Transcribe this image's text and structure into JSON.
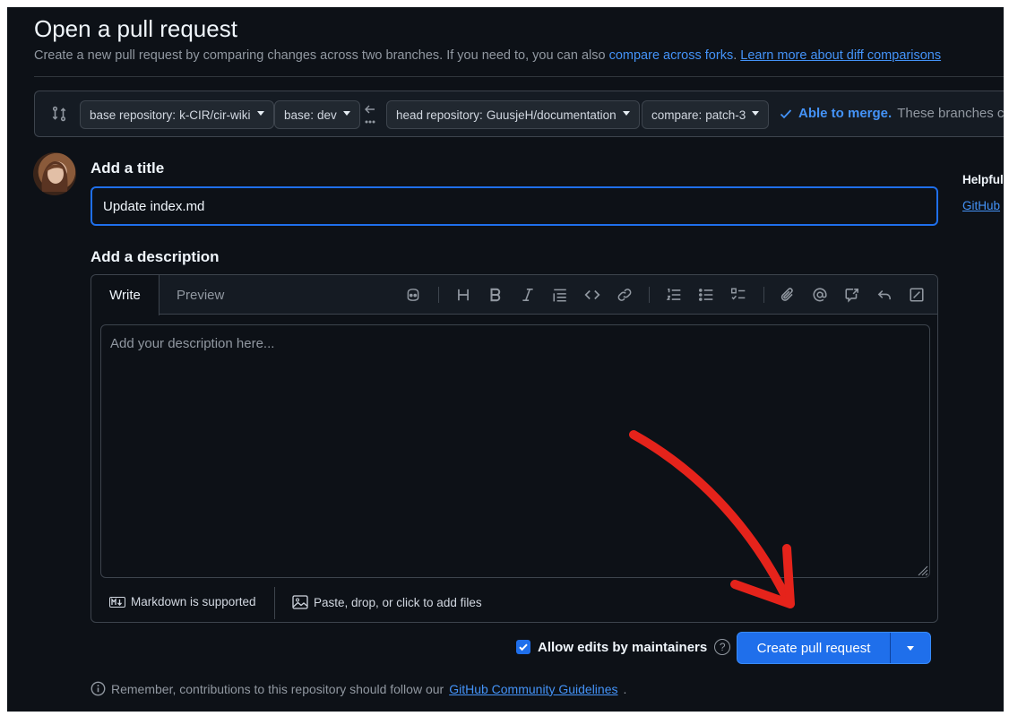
{
  "page": {
    "title": "Open a pull request",
    "subtitle_text": "Create a new pull request by comparing changes across two branches. If you need to, you can also ",
    "subtitle_link1": "compare across forks",
    "subtitle_link2": "Learn more about diff comparisons"
  },
  "range": {
    "base_repo_key": "base repository:",
    "base_repo_value": "k-CIR/cir-wiki",
    "base_key": "base:",
    "base_value": "dev",
    "head_repo_key": "head repository:",
    "head_repo_value": "GuusjeH/documentation",
    "compare_key": "compare:",
    "compare_value": "patch-3",
    "merge_status": "Able to merge.",
    "merge_rest": "These branches c"
  },
  "form": {
    "title_label": "Add a title",
    "title_value": "Update index.md",
    "description_label": "Add a description",
    "tab_write": "Write",
    "tab_preview": "Preview",
    "description_placeholder": "Add your description here...",
    "markdown_note": "Markdown is supported",
    "attach_note": "Paste, drop, or click to add files"
  },
  "sidebar": {
    "heading": "Helpful",
    "link": "GitHub"
  },
  "actions": {
    "allow_edits_label": "Allow edits by maintainers",
    "allow_edits_checked": true,
    "help_glyph": "?",
    "create_button": "Create pull request"
  },
  "footer": {
    "note_text": "Remember, contributions to this repository should follow our ",
    "note_link": "GitHub Community Guidelines",
    "note_end": "."
  },
  "icons": [
    "compare-icon",
    "arrow-left-icon",
    "check-icon",
    "copilot-icon",
    "heading-icon",
    "bold-icon",
    "italic-icon",
    "quote-icon",
    "code-icon",
    "link-icon",
    "ordered-list-icon",
    "unordered-list-icon",
    "task-list-icon",
    "paperclip-icon",
    "mention-icon",
    "cross-reference-icon",
    "reply-icon",
    "fullscreen-icon",
    "markdown-icon",
    "image-icon",
    "info-icon"
  ],
  "colors": {
    "background": "#0d1117",
    "accent": "#1f6feb",
    "link": "#4493f8",
    "annotation_arrow": "#e5231b"
  }
}
